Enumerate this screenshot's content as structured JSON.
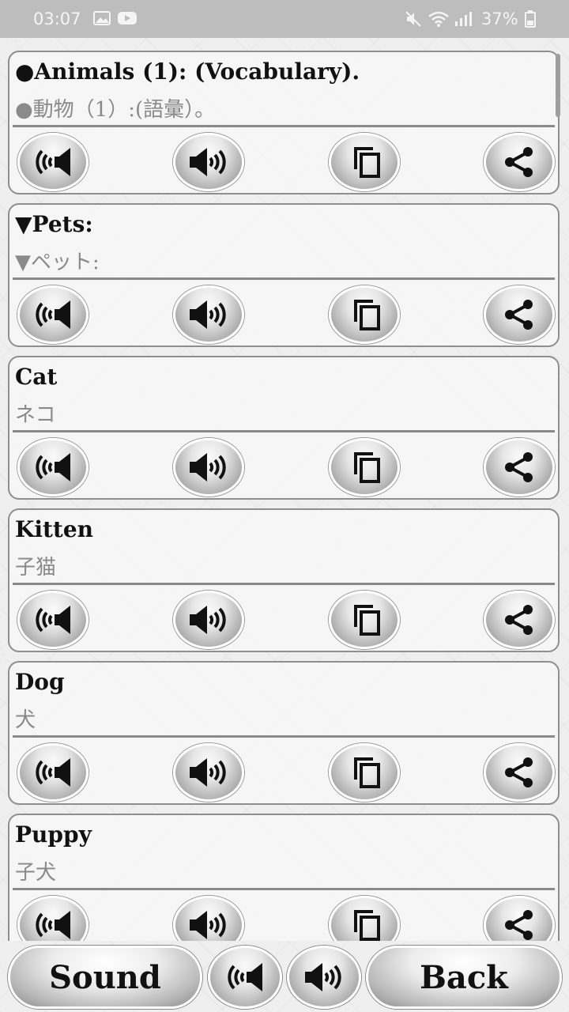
{
  "status_bar": {
    "time": "03:07",
    "battery": "37%",
    "icons": [
      "gallery-icon",
      "youtube-icon",
      "mute-icon",
      "wifi-icon",
      "signal-icon",
      "battery-icon"
    ]
  },
  "cards": [
    {
      "title": "●Animals (1): (Vocabulary).",
      "subtitle": "●動物（1）:(語彙）。"
    },
    {
      "title": "▼Pets:",
      "subtitle": "▼ペット:"
    },
    {
      "title": "Cat",
      "subtitle": "ネコ"
    },
    {
      "title": "Kitten",
      "subtitle": "子猫"
    },
    {
      "title": "Dog",
      "subtitle": "犬"
    },
    {
      "title": "Puppy",
      "subtitle": "子犬"
    }
  ],
  "card_actions": [
    "speaker-slow-icon",
    "speaker-loud-icon",
    "copy-icon",
    "share-icon"
  ],
  "bottom_bar": {
    "sound_label": "Sound",
    "back_label": "Back"
  },
  "colors": {
    "status_bar": "#bdbdbd",
    "background": "#efefef",
    "card_border": "#8f8f8f",
    "title_text": "#111111",
    "subtitle_text": "#8a8a8a"
  }
}
